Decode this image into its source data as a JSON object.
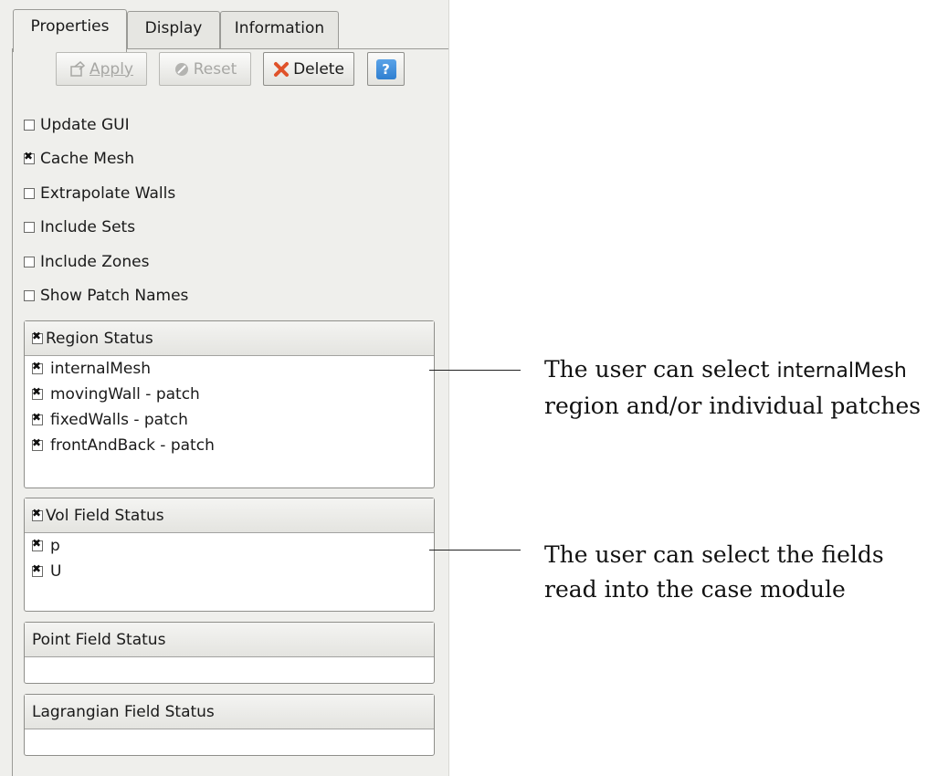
{
  "tabs": [
    "Properties",
    "Display",
    "Information"
  ],
  "toolbar": {
    "apply_label": "Apply",
    "reset_label": "Reset",
    "delete_label": "Delete",
    "help_label": "?"
  },
  "options": [
    {
      "label": "Update GUI",
      "checked": false
    },
    {
      "label": "Cache Mesh",
      "checked": true
    },
    {
      "label": "Extrapolate Walls",
      "checked": false
    },
    {
      "label": "Include Sets",
      "checked": false
    },
    {
      "label": "Include Zones",
      "checked": false
    },
    {
      "label": "Show Patch Names",
      "checked": false
    }
  ],
  "region_status": {
    "title": "Region Status",
    "items": [
      "internalMesh",
      "movingWall - patch",
      "fixedWalls - patch",
      "frontAndBack - patch"
    ]
  },
  "vol_field_status": {
    "title": "Vol Field Status",
    "items": [
      "p",
      "U"
    ]
  },
  "point_field_status": {
    "title": "Point Field Status"
  },
  "lagrangian_field_status": {
    "title": "Lagrangian Field Status"
  },
  "annotations": {
    "region_pre": "The user can select ",
    "region_highlight": "internalMesh",
    "region_line2": "region and/or individual patches",
    "fields_line1": "The user can select the fields",
    "fields_line2": "read into the case module"
  },
  "colors": {
    "delete_icon": "#e0522a",
    "help_icon": "#2f7fd0",
    "panel_bg": "#efefec"
  }
}
